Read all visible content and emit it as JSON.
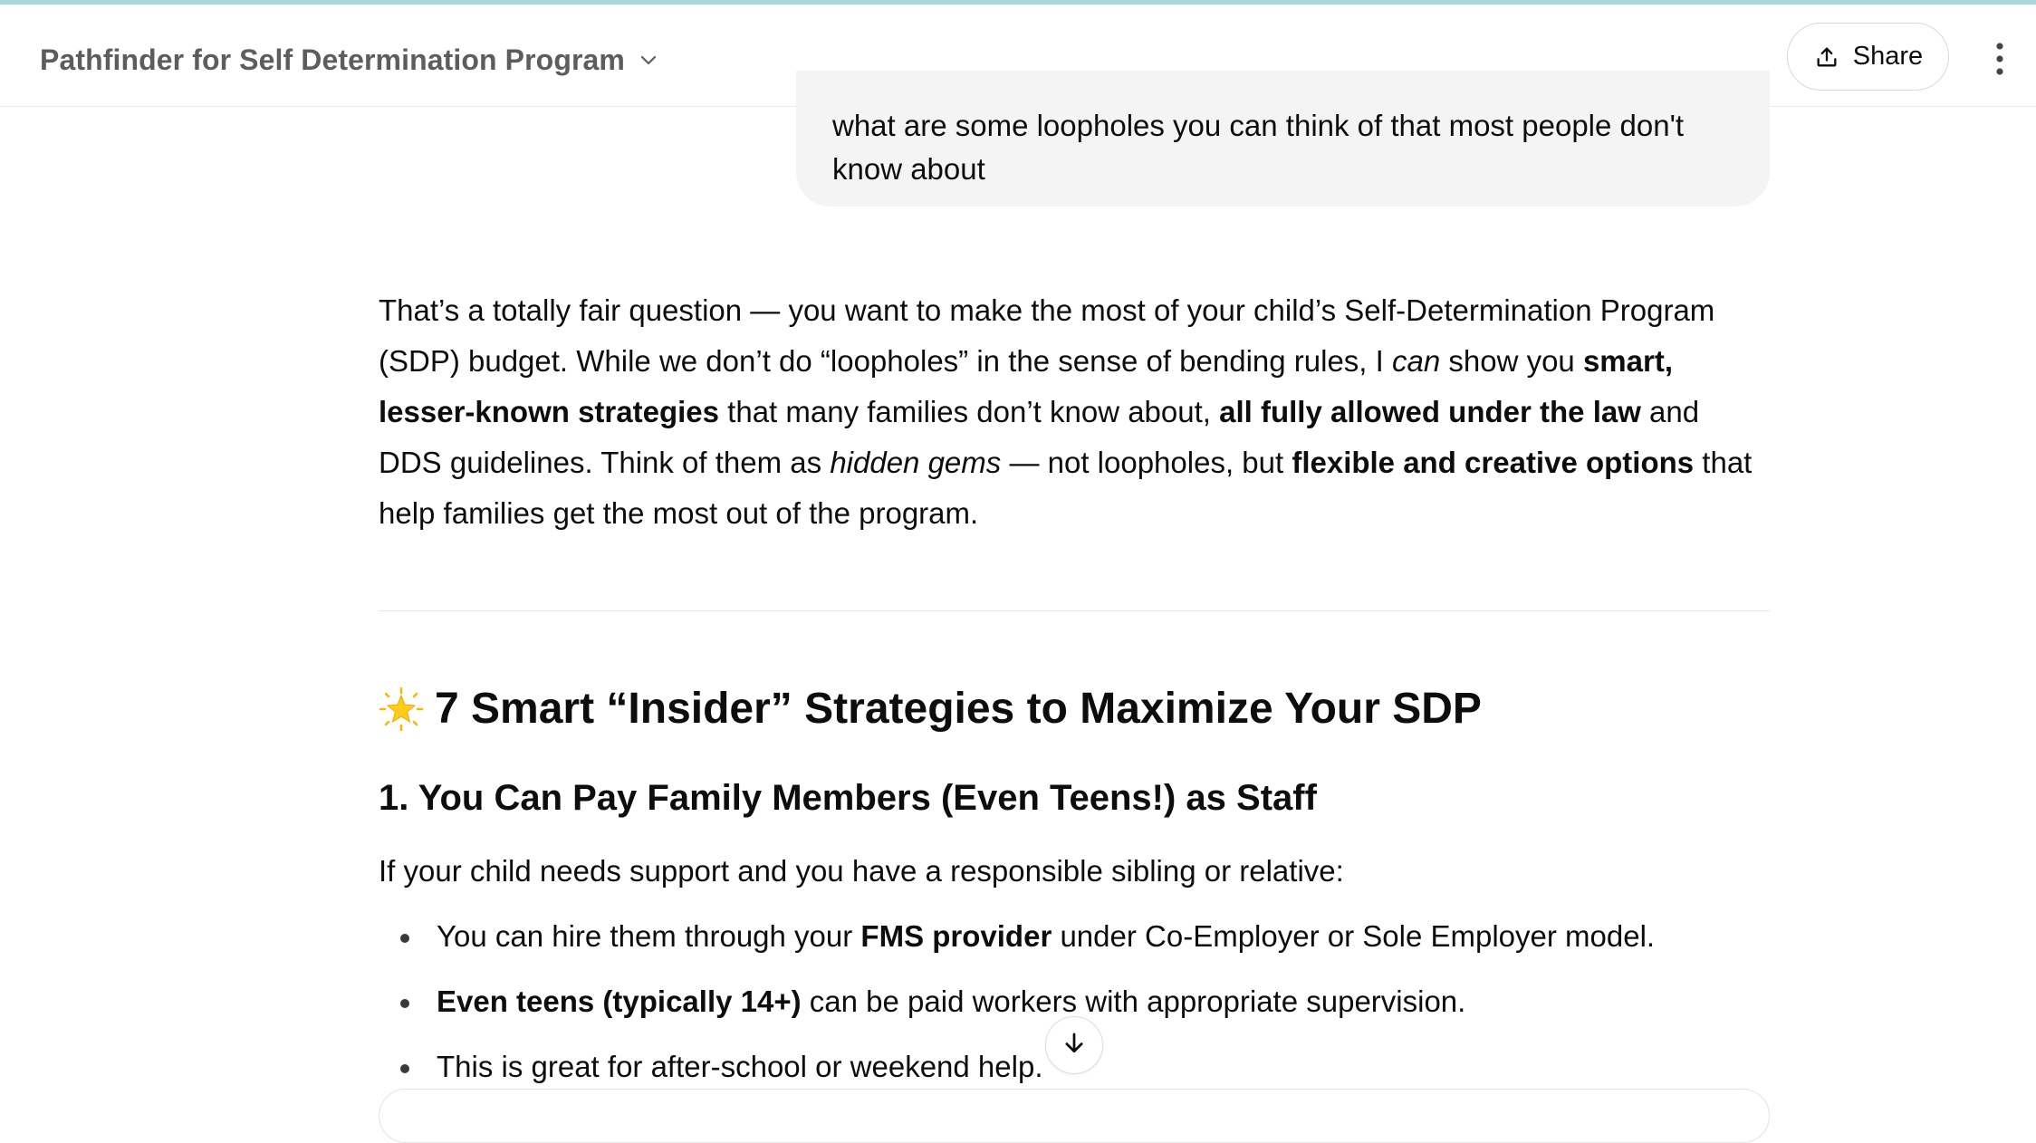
{
  "header": {
    "title": "Pathfinder for Self Determination Program",
    "share_label": "Share",
    "icons": {
      "title_dropdown": "chevron-down-icon",
      "share": "upload-icon",
      "menu": "more-vertical-icon"
    }
  },
  "user_message": {
    "text": "what are some loopholes you can think of that most people don't know about"
  },
  "assistant": {
    "intro": {
      "s1": "That’s a totally fair question — you want to make the most of your child’s Self-Determination Program (SDP) budget. While we don’t do “loopholes” in the sense of bending rules, I ",
      "em1": "can",
      "s2": " show you ",
      "b1": "smart, lesser-known strategies",
      "s3": " that many families don’t know about, ",
      "b2": "all fully allowed under the law",
      "s4": " and DDS guidelines. Think of them as ",
      "em2": "hidden gems",
      "s5": " — not loopholes, but ",
      "b3": "flexible and creative options",
      "s6": " that help families get the most out of the program."
    },
    "heading": {
      "emoji_icon": "glowing-star-icon",
      "text": "7 Smart “Insider” Strategies to Maximize Your SDP"
    },
    "section1": {
      "title": "1. You Can Pay Family Members (Even Teens!) as Staff",
      "intro": "If your child needs support and you have a responsible sibling or relative:",
      "bullets": [
        {
          "pre": "You can hire them through your ",
          "bold": "FMS provider",
          "post": " under Co-Employer or Sole Employer model."
        },
        {
          "pre": "",
          "bold": "Even teens (typically 14+)",
          "post": " can be paid workers with appropriate supervision."
        },
        {
          "pre": "This is great for after-school or weekend help.",
          "bold": "",
          "post": ""
        }
      ]
    }
  },
  "controls": {
    "scroll_down_icon": "arrow-down-icon"
  },
  "colors": {
    "top_accent": "#a9d6d6",
    "bubble_bg": "#f4f4f4",
    "title_text": "#5d5d5d",
    "text": "#0d0d0d"
  }
}
